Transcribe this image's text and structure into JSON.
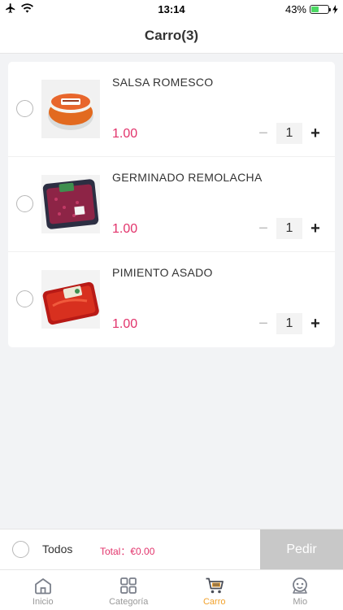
{
  "status_bar": {
    "time": "13:14",
    "battery_percent": "43%",
    "battery_level": 0.43
  },
  "nav": {
    "title": "Carro",
    "count": "(3)"
  },
  "cart": {
    "items": [
      {
        "name": "SALSA ROMESCO",
        "price": "1.00",
        "quantity": "1",
        "minus": "−",
        "plus": "+"
      },
      {
        "name": "GERMINADO REMOLACHA",
        "price": "1.00",
        "quantity": "1",
        "minus": "−",
        "plus": "+"
      },
      {
        "name": "PIMIENTO ASADO",
        "price": "1.00",
        "quantity": "1",
        "minus": "−",
        "plus": "+"
      }
    ]
  },
  "checkout": {
    "select_all_label": "Todos",
    "total": "Total：€0.00",
    "order_button": "Pedir"
  },
  "tabs": [
    {
      "label": "Inicio",
      "icon": "home-icon"
    },
    {
      "label": "Categoría",
      "icon": "grid-icon"
    },
    {
      "label": "Carro",
      "icon": "cart-icon",
      "active": true
    },
    {
      "label": "Mio",
      "icon": "profile-icon"
    }
  ],
  "colors": {
    "accent": "#f2a12a",
    "price": "#e2336b",
    "order_disabled": "#c8c8c8"
  }
}
